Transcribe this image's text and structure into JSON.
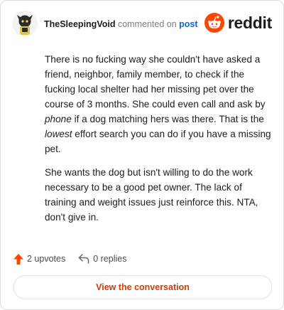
{
  "comment": {
    "username": "TheSleepingVoid",
    "commented_on_text": "commented on",
    "post_link_label": "post",
    "paragraph1": {
      "part1": "There is no fucking way she couldn't have asked a friend, neighbor, family member, to check if the fucking local shelter had her missing pet over the course of 3 months. She could even call and ask by ",
      "em1": "phone",
      "part2": " if a dog matching hers was there. That is the ",
      "em2": "lowest",
      "part3": " effort search you can do if you have a missing pet."
    },
    "paragraph2": "She wants the dog but isn't willing to do the work necessary to be a good pet owner. The lack of training and weight issues just reinforce this. NTA, don't give in."
  },
  "brand": {
    "logo_text": "reddit",
    "icon": "reddit-alien-icon",
    "color": "#ff4500"
  },
  "stats": {
    "upvotes_label": "2 upvotes",
    "replies_label": "0 replies"
  },
  "actions": {
    "view_conversation_label": "View the conversation"
  },
  "colors": {
    "accent": "#d93a00",
    "upvote": "#ff4500",
    "link": "#0a66d6"
  }
}
